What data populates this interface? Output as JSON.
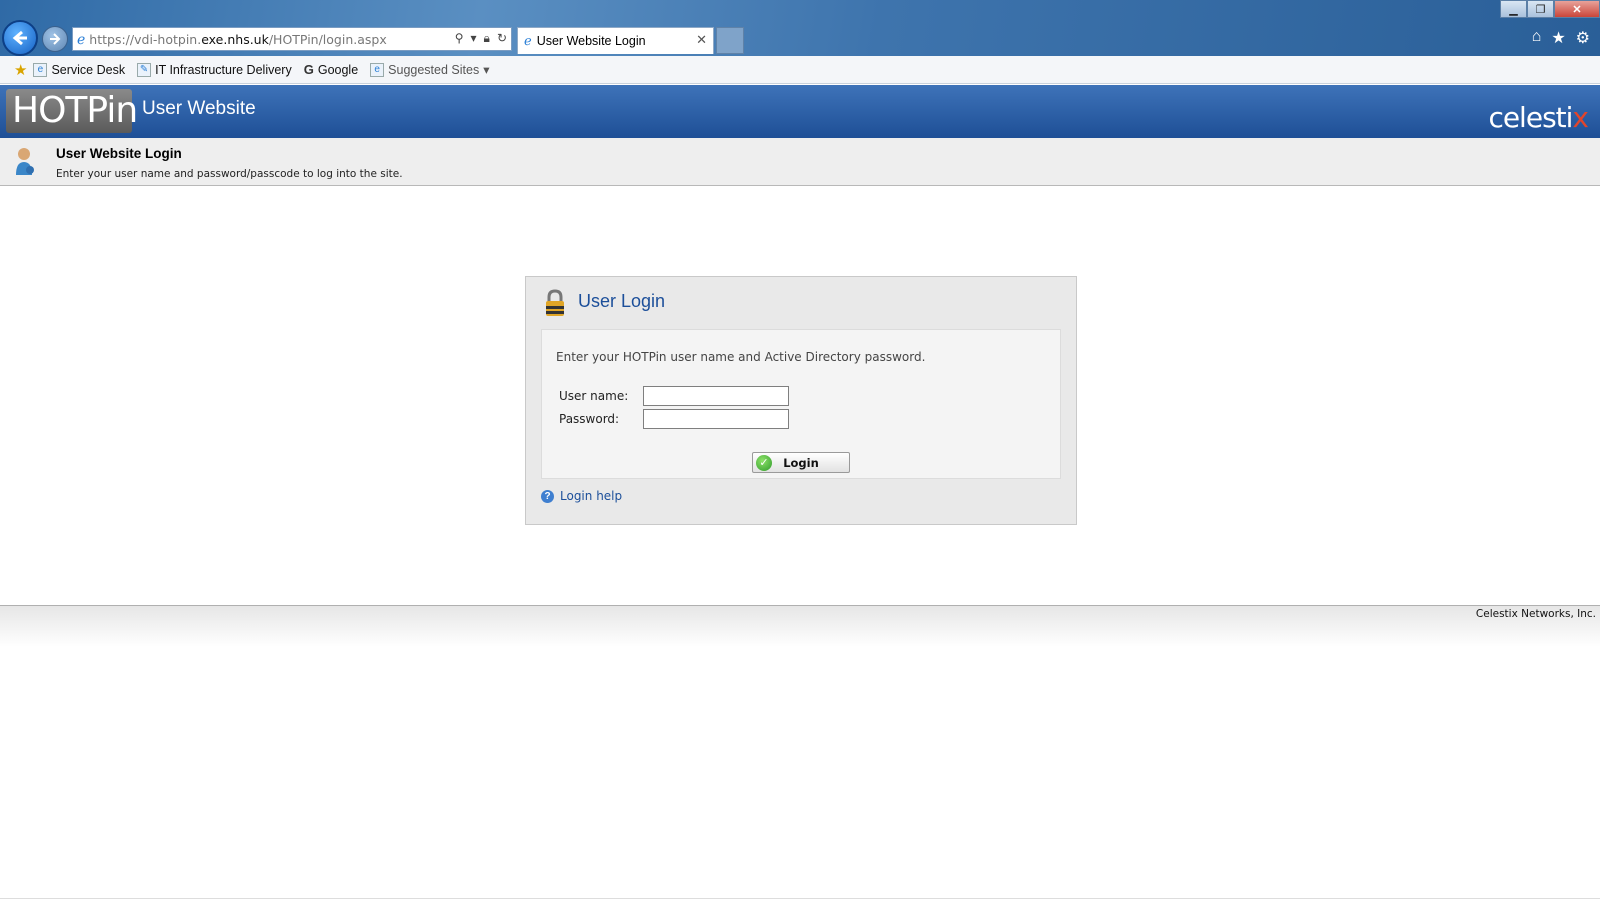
{
  "browser": {
    "url": {
      "prefix": "https://",
      "host_pre": "vdi-hotpin.",
      "host_main": "exe.nhs.uk",
      "path": "/HOTPin/login.aspx"
    },
    "tab_title": "User Website Login",
    "favorites": [
      {
        "label": "Service Desk",
        "icon": "ie-page-icon"
      },
      {
        "label": "IT Infrastructure Delivery",
        "icon": "tools-icon"
      },
      {
        "label": "Google",
        "icon": "google-icon"
      },
      {
        "label": "Suggested Sites",
        "icon": "ie-page-icon"
      }
    ]
  },
  "header": {
    "logo_text": "HOTPin",
    "site_title": "User Website",
    "brand": {
      "main": "celesti",
      "accent": "x"
    }
  },
  "banner": {
    "title": "User Website Login",
    "subtitle": "Enter your user name and password/passcode to log into the site."
  },
  "login": {
    "title": "User Login",
    "instructions": "Enter your HOTPin user name and Active Directory password.",
    "username_label": "User name:",
    "password_label": "Password:",
    "username_value": "",
    "password_value": "",
    "button_label": "Login",
    "help_label": "Login help"
  },
  "footer": {
    "text": "Celestix Networks, Inc."
  },
  "colors": {
    "header_blue": "#2a5fa6",
    "link_blue": "#1c4f9a",
    "brand_accent": "#e2452b"
  }
}
